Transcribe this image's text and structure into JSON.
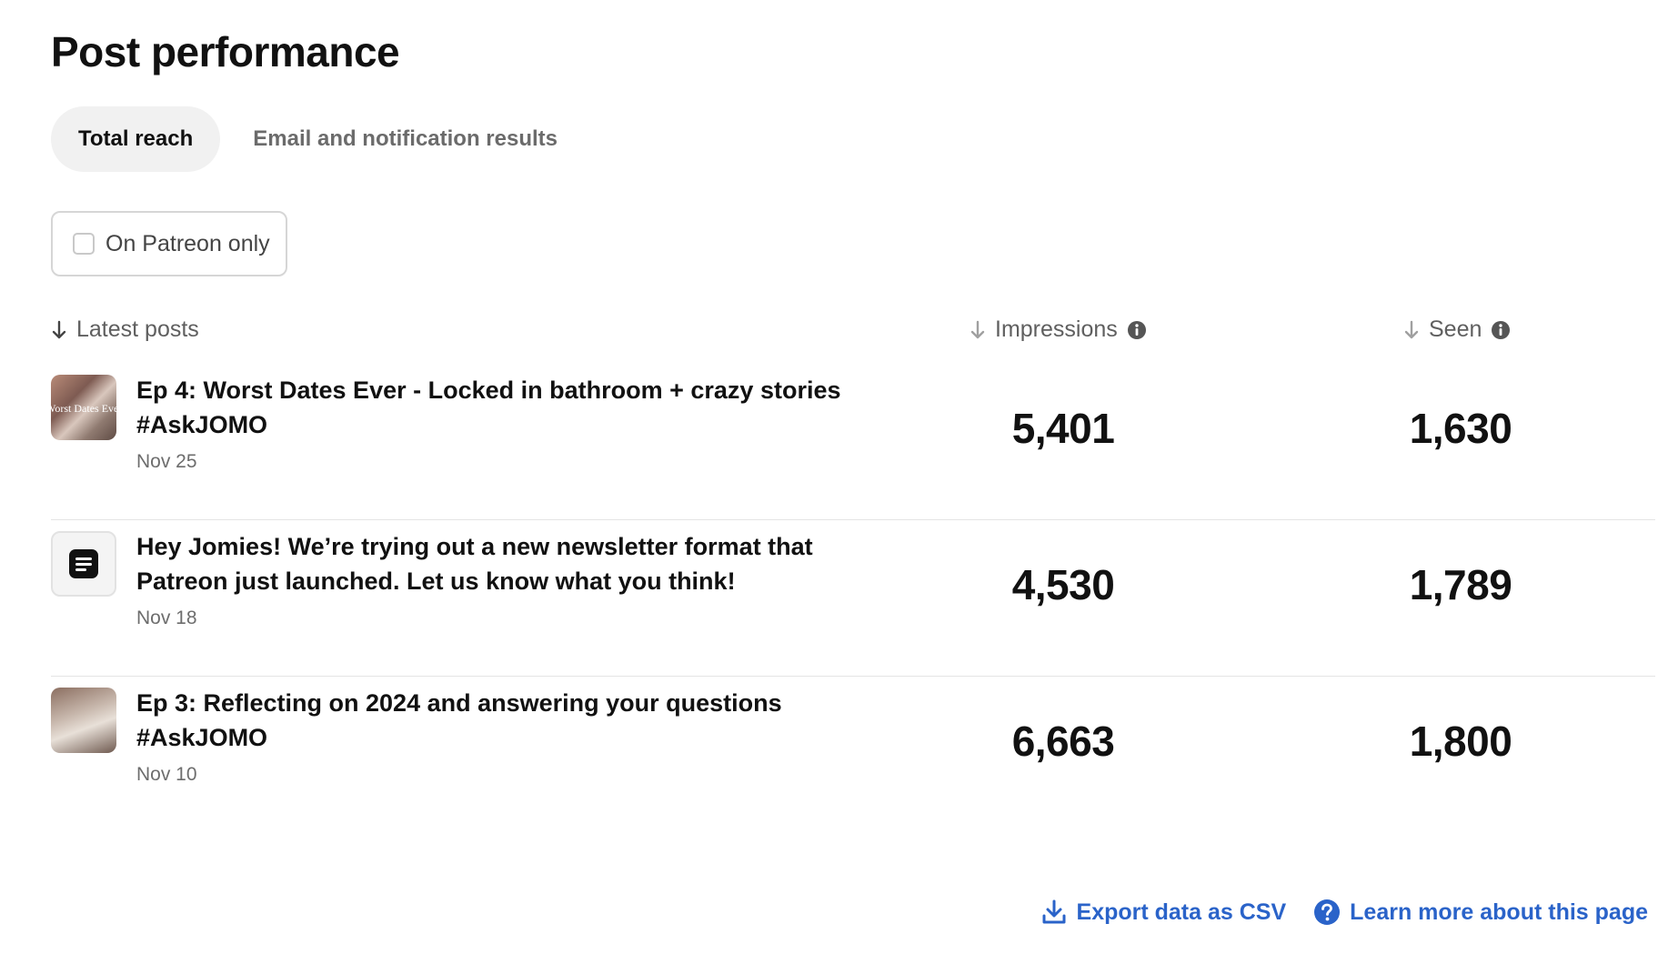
{
  "page_title": "Post performance",
  "tabs": [
    {
      "label": "Total reach",
      "active": true
    },
    {
      "label": "Email and notification results",
      "active": false
    }
  ],
  "filter": {
    "label": "On Patreon only",
    "checked": false
  },
  "columns": {
    "posts": "Latest posts",
    "impressions": "Impressions",
    "seen": "Seen"
  },
  "posts": [
    {
      "thumbnail": "photo",
      "thumbnail_text": "Worst Dates Ever",
      "title": "Ep 4: Worst Dates Ever - Locked in bathroom + crazy stories #AskJOMO",
      "date": "Nov 25",
      "impressions": "5,401",
      "seen": "1,630"
    },
    {
      "thumbnail": "text-post-icon",
      "title": "Hey Jomies! We’re trying out a new newsletter format that Patreon just launched. Let us know what you think!",
      "date": "Nov 18",
      "impressions": "4,530",
      "seen": "1,789"
    },
    {
      "thumbnail": "photo",
      "title": "Ep 3: Reflecting on 2024 and answering your questions #AskJOMO",
      "date": "Nov 10",
      "impressions": "6,663",
      "seen": "1,800"
    }
  ],
  "footer": {
    "export_label": "Export data as CSV",
    "learn_label": "Learn more about this page"
  },
  "colors": {
    "link": "#2a63c9",
    "active_tab_bg": "#f1f1f1"
  }
}
